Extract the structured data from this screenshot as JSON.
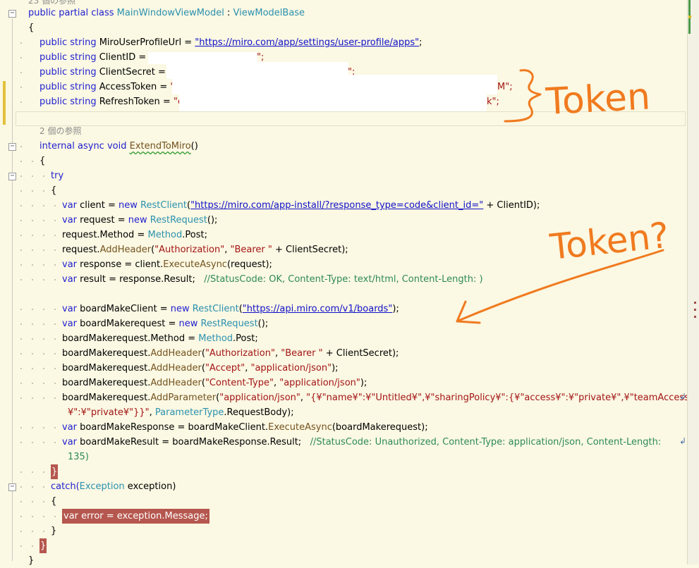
{
  "references": {
    "top": "23 個の参照",
    "method": "2 個の参照"
  },
  "class_decl": {
    "mods": "public partial class",
    "name": "MainWindowViewModel",
    "colon": ":",
    "base": "ViewModelBase"
  },
  "fields": {
    "mods": "public string",
    "url_name": "MiroUserProfileUrl =",
    "url_value": "\"https://miro.com/app/settings/user-profile/apps\"",
    "client_id_name": "ClientID =",
    "client_id_prefix": "\"",
    "client_id_suffix": "\";",
    "client_secret_name": "ClientSecret =",
    "client_secret_prefix": "\"",
    "client_secret_suffix": "\";",
    "access_token_name": "AccessToken =",
    "access_token_prefix": "\"e",
    "access_token_suffix": "M\";",
    "refresh_token_name": "RefreshToken =",
    "refresh_token_prefix": "\"e",
    "refresh_token_suffix": "k\";"
  },
  "method": {
    "mods": "internal async void",
    "name": "ExtendToMiro",
    "parens": "()"
  },
  "keywords": {
    "try": "try",
    "catch": "catch(",
    "exception_type": "Exception",
    "exception_var": "exception)",
    "var": "var",
    "new": "new"
  },
  "code": {
    "l1_name": "client =",
    "l1_type": "RestClient",
    "l1_url": "\"https://miro.com/app-install/?response_type=code&client_id=\"",
    "l1_rest": "+ ClientID);",
    "l2_name": "request =",
    "l2_type": "RestRequest",
    "l2_rest": "();",
    "l3_a": "request.Method =",
    "l3_type": "Method",
    "l3_b": ".Post;",
    "l4_a": "request.",
    "l4_method": "AddHeader",
    "l4_s1": "\"Authorization\"",
    "l4_comma": ",",
    "l4_s2": "\"Bearer \"",
    "l4_rest": "+ ClientSecret);",
    "l5_name": "response =",
    "l5_a": "client.",
    "l5_method": "ExecuteAsync",
    "l5_rest": "(request);",
    "l6_name": "result =",
    "l6_a": "response.Result;",
    "l6_comment": "//StatusCode: OK, Content-Type: text/html, Content-Length: )",
    "b1_name": "boardMakeClient =",
    "b1_type": "RestClient",
    "b1_url": "\"https://api.miro.com/v1/boards\"",
    "b1_rest": ");",
    "b2_name": "boardMakerequest =",
    "b2_type": "RestRequest",
    "b2_rest": "();",
    "b3_a": "boardMakerequest.Method =",
    "b3_type": "Method",
    "b3_b": ".Post;",
    "b4_a": "boardMakerequest.",
    "b4_method": "AddHeader",
    "b4_s1": "\"Authorization\"",
    "b4_s2": "\"Bearer \"",
    "b4_rest": "+ ClientSecret);",
    "b5_s1": "\"Accept\"",
    "b5_s2": "\"application/json\"",
    "b5_rest": ");",
    "b6_s1": "\"Content-Type\"",
    "b6_s2": "\"application/json\"",
    "b6_rest": ");",
    "b7_method": "AddParameter",
    "b7_s1": "\"application/json\"",
    "b7_s2": "\"{¥\"name¥\":¥\"Untitled¥\",¥\"sharingPolicy¥\":{¥\"access¥\":¥\"private¥\",¥\"teamAccess",
    "b7_s3": "¥\":¥\"private¥\"}}\"",
    "b7_type": "ParameterType",
    "b7_rest": ".RequestBody);",
    "b8_name": "boardMakeResponse =",
    "b8_a": "boardMakeClient.",
    "b8_method": "ExecuteAsync",
    "b8_rest": "(boardMakerequest);",
    "b9_name": "boardMakeResult =",
    "b9_a": "boardMakeResponse.Result;",
    "b9_comment": "//StatusCode: Unauthorized, Content-Type: application/json, Content-Length:",
    "b9_cont": "135)",
    "err_name": "error",
    "err_rest": "= exception.Message;"
  },
  "braces": {
    "open": "{",
    "close": "}"
  },
  "annotations": {
    "token_label": "Token",
    "token_question": "Token?",
    "ink_color": "#f07a1f"
  },
  "colors": {
    "background": "#fbf8e3",
    "keyword": "#1f1fd0",
    "type": "#2b91af",
    "string": "#a31515",
    "comment": "#2e8b57",
    "highlight": "#b5574e"
  }
}
